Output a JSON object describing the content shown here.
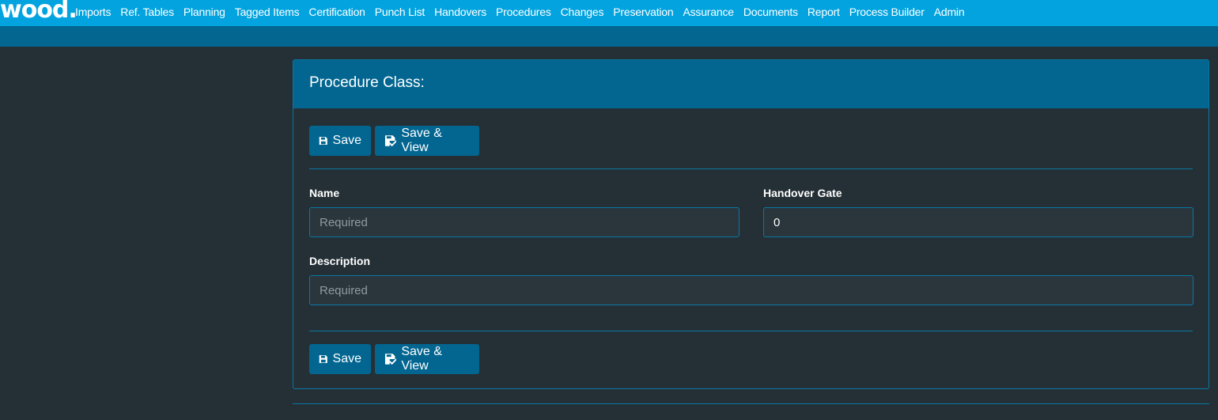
{
  "app": {
    "logo_text": "wood",
    "logo_dot": "."
  },
  "nav": {
    "items": [
      "Imports",
      "Ref. Tables",
      "Planning",
      "Tagged Items",
      "Certification",
      "Punch List",
      "Handovers",
      "Procedures",
      "Changes",
      "Preservation",
      "Assurance",
      "Documents",
      "Report",
      "Process Builder",
      "Admin"
    ]
  },
  "panel": {
    "title": "Procedure Class:",
    "save_label": "Save",
    "save_view_label": "Save & View"
  },
  "form": {
    "name": {
      "label": "Name",
      "placeholder": "Required",
      "value": ""
    },
    "handover_gate": {
      "label": "Handover Gate",
      "value": "0"
    },
    "description": {
      "label": "Description",
      "placeholder": "Required",
      "value": ""
    }
  },
  "colors": {
    "nav_bg": "#02a3df",
    "subbar_bg": "#026691",
    "page_bg": "#243036",
    "border": "#0b77a4"
  }
}
